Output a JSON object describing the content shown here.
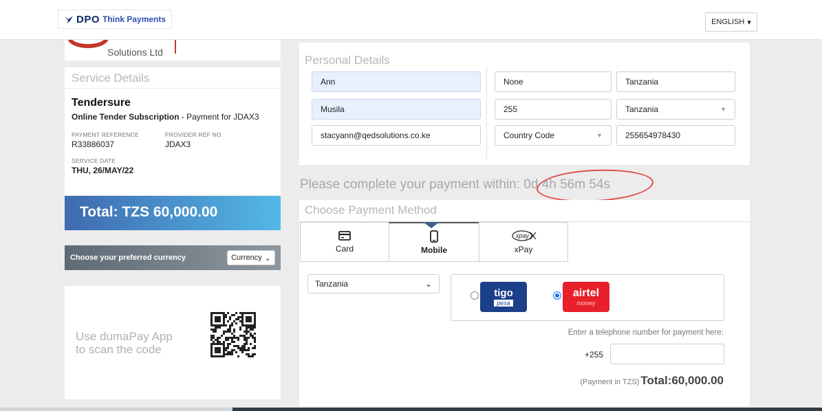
{
  "header": {
    "logo_mark": "DPO",
    "logo_tagline": "Think Payments",
    "language": "ENGLISH"
  },
  "merchant": {
    "name": "Solutions Ltd"
  },
  "service": {
    "title": "Service Details",
    "name": "Tendersure",
    "description_bold": "Online Tender Subscription",
    "description_rest": " - Payment for JDAX3",
    "payment_reference_label": "PAYMENT REFERENCE",
    "payment_reference": "R33886037",
    "provider_ref_label": "PROVIDER REF NO.",
    "provider_ref": "JDAX3",
    "service_date_label": "SERVICE DATE",
    "service_date": "THU, 26/MAY/22"
  },
  "total": {
    "label": "Total: TZS 60,000.00"
  },
  "currency": {
    "label": "Choose your preferred currency",
    "select_value": "Currency"
  },
  "qr": {
    "text_line1": "Use dumaPay App",
    "text_line2": "to scan the code"
  },
  "personal": {
    "title": "Personal Details",
    "first_name": "Ann",
    "last_name": "Musila",
    "email": "stacyann@qedsolutions.co.ke",
    "field_none": "None",
    "dial_code": "255",
    "country_code_select": "Country Code",
    "country_1": "Tanzania",
    "country_2": "Tanzania",
    "phone": "255654978430"
  },
  "timer": {
    "prefix": "Please complete your payment within:",
    "value": "0d 4h 56m 54s",
    "highlight_color": "#e04a4a"
  },
  "payment": {
    "title": "Choose Payment Method",
    "tabs": [
      {
        "label": "Card",
        "icon": "credit-card-icon"
      },
      {
        "label": "Mobile",
        "icon": "mobile-phone-icon",
        "active": true
      },
      {
        "label": "xPay",
        "icon": "xpay-logo-icon",
        "logo_text": "xpay"
      }
    ],
    "country_select": "Tanzania",
    "operators": [
      {
        "name": "tigo",
        "sub": "pesa",
        "selected": false
      },
      {
        "name": "airtel",
        "sub": "money",
        "selected": true
      }
    ],
    "phone_hint": "Enter a telephone number for payment here:",
    "phone_prefix": "+255",
    "phone_value": "",
    "total_currency_note": "(Payment in TZS)",
    "total_amount": "Total:60,000.00"
  },
  "colors": {
    "total_band_start": "#3f6ab0",
    "total_band_end": "#53b8e6",
    "tigo": "#1d3f8a",
    "airtel": "#e8202a"
  }
}
